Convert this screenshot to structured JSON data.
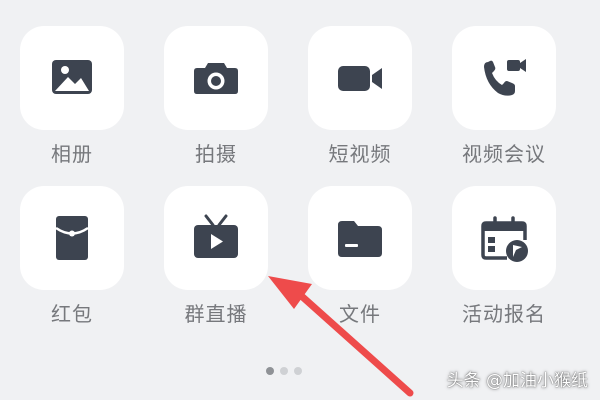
{
  "colors": {
    "background": "#f0f1f3",
    "tile": "#ffffff",
    "icon": "#3d4450",
    "label": "#76787c",
    "arrow": "#ee4b4b"
  },
  "apps": [
    {
      "label": "相册",
      "icon": "photo-icon"
    },
    {
      "label": "拍摄",
      "icon": "camera-icon"
    },
    {
      "label": "短视频",
      "icon": "video-camera-icon"
    },
    {
      "label": "视频会议",
      "icon": "video-call-icon"
    },
    {
      "label": "红包",
      "icon": "red-packet-icon"
    },
    {
      "label": "群直播",
      "icon": "live-tv-icon"
    },
    {
      "label": "文件",
      "icon": "folder-icon"
    },
    {
      "label": "活动报名",
      "icon": "calendar-flag-icon"
    }
  ],
  "pagination": {
    "pages": 3,
    "current": 1
  },
  "watermark": {
    "text": "头条 @加油小猴纸"
  }
}
